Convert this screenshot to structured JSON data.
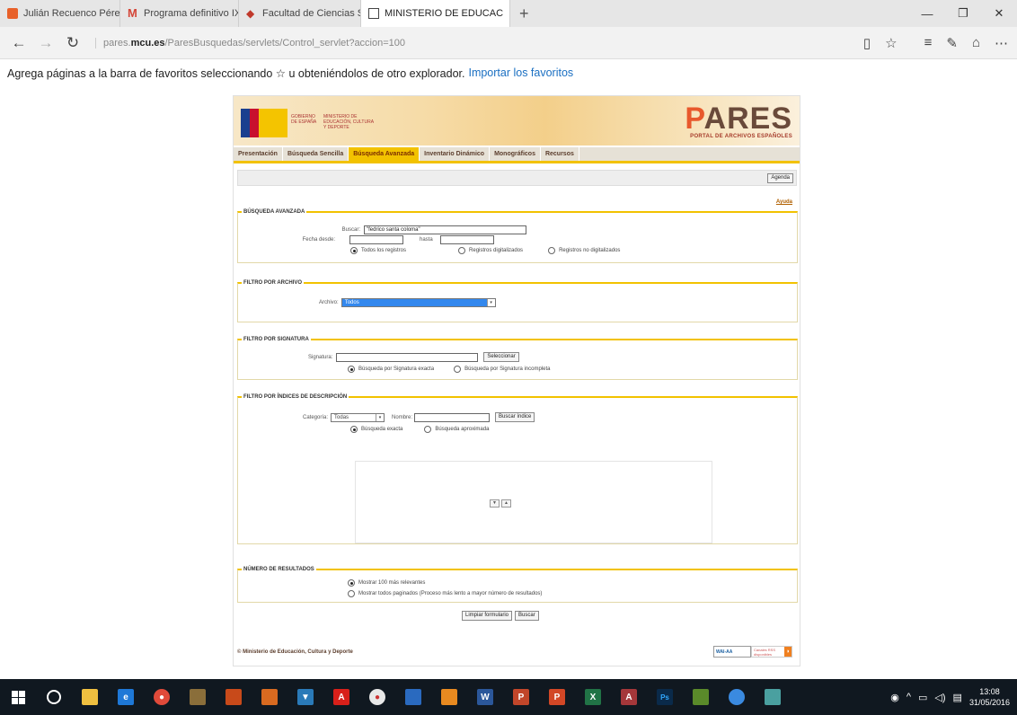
{
  "browser": {
    "tabs": [
      {
        "title": "Julián Recuenco Pérez, histc",
        "icon": "orange-square-icon",
        "color": "#e8612a"
      },
      {
        "title": "Programa definitivo IX Jorn",
        "icon": "gmail-icon",
        "color": "#d44638"
      },
      {
        "title": "Facultad de Ciencias Sociale",
        "icon": "red-diamond-icon",
        "color": "#c0392b"
      },
      {
        "title": "MINISTERIO DE EDUCAC",
        "icon": "page-icon",
        "color": "#333333"
      }
    ],
    "url_prefix": "pares.",
    "url_domain": "mcu.es",
    "url_path": "/ParesBusquedas/servlets/Control_servlet?accion=100",
    "favorites_message": "Agrega páginas a la barra de favoritos seleccionando ☆ u obteniéndolos de otro explorador.",
    "favorites_link": "Importar los favoritos"
  },
  "site": {
    "gov_text": "GOBIERNO DE ESPAÑA",
    "ministry_text": "MINISTERIO DE EDUCACIÓN, CULTURA Y DEPORTE",
    "logo_p": "P",
    "logo_rest": "ARES",
    "logo_subtitle": "PORTAL DE ARCHIVOS ESPAÑOLES",
    "nav": [
      "Presentación",
      "Búsqueda Sencilla",
      "Búsqueda Avanzada",
      "Inventario Dinámico",
      "Monográficos",
      "Recursos"
    ],
    "agenda_label": "Agenda",
    "ayuda_label": "Ayuda"
  },
  "busqueda": {
    "legend": "BÚSQUEDA AVANZADA",
    "buscar_label": "Buscar:",
    "buscar_value": "\"fedrico santa coloma\"",
    "fecha_desde_label": "Fecha desde:",
    "hasta_label": "hasta",
    "options": [
      "Todos los registros",
      "Registros digitalizados",
      "Registros no digitalizados"
    ]
  },
  "archivo": {
    "legend": "FILTRO POR ARCHIVO",
    "label": "Archivo:",
    "value": "Todos"
  },
  "signatura": {
    "legend": "FILTRO POR SIGNATURA",
    "label": "Signatura:",
    "button": "Seleccionar",
    "options": [
      "Búsqueda por Signatura exacta",
      "Búsqueda por Signatura incompleta"
    ]
  },
  "indices": {
    "legend": "FILTRO POR ÍNDICES DE DESCRIPCIÓN",
    "categoria_label": "Categoría:",
    "categoria_value": "Todas",
    "nombre_label": "Nombre:",
    "button": "Buscar índice",
    "options": [
      "Búsqueda exacta",
      "Búsqueda aproximada"
    ]
  },
  "resultados": {
    "legend": "NÚMERO DE RESULTADOS",
    "options": [
      "Mostrar 100 más relevantes",
      "Mostrar todos paginados (Proceso más lento a mayor número de resultados)"
    ],
    "clear_button": "Limpiar formulario",
    "search_button": "Buscar"
  },
  "footer": {
    "copyright": "© Ministerio de Educación, Cultura y Deporte",
    "wai_label": "WAI-AA",
    "rss_label": "Canales RSS disponibles"
  },
  "taskbar": {
    "time": "13:08",
    "date": "31/05/2016"
  }
}
